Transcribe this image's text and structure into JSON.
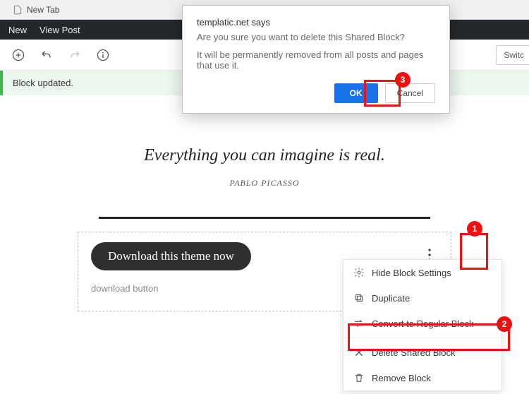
{
  "browser": {
    "tab_title": "New Tab"
  },
  "menubar": {
    "item1": "New",
    "item2": "View Post"
  },
  "toolbar": {
    "switch_label": "Switc"
  },
  "notice": {
    "message": "Block updated."
  },
  "content": {
    "quote": "Everything you can imagine is real.",
    "citation": "PABLO PICASSO",
    "button_label": "Download this theme now",
    "block_name": "download button"
  },
  "menu": {
    "hide": "Hide Block Settings",
    "duplicate": "Duplicate",
    "convert": "Convert to Regular Block",
    "delete": "Delete Shared Block",
    "remove": "Remove Block"
  },
  "dialog": {
    "title": "templatic.net says",
    "line1": "Are you sure you want to delete this Shared Block?",
    "line2": "It will be permanently removed from all posts and pages that use it.",
    "ok": "OK",
    "cancel": "Cancel"
  },
  "callouts": {
    "one": "1",
    "two": "2",
    "three": "3"
  }
}
